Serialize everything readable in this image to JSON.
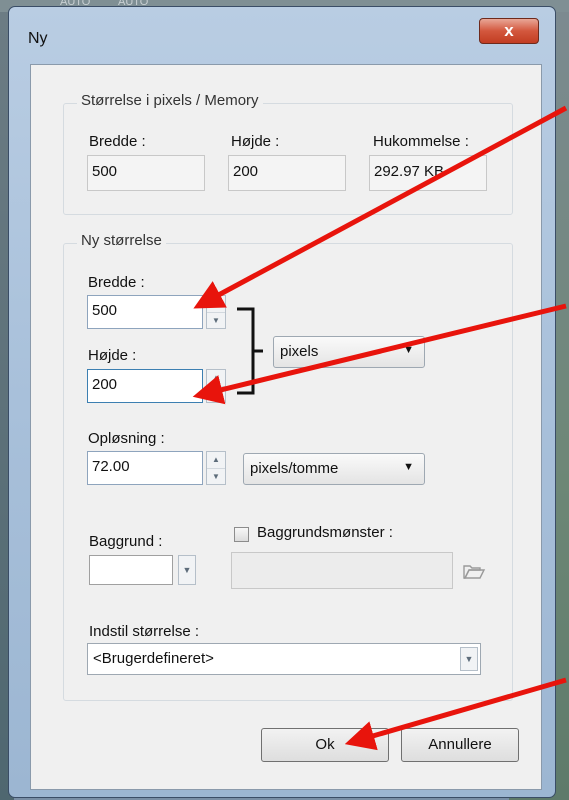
{
  "window": {
    "title": "Ny",
    "close_glyph": "x",
    "top_strip": [
      "AUTO",
      "AUTO"
    ]
  },
  "size_group": {
    "title": "Størrelse i pixels / Memory",
    "width_label": "Bredde :",
    "width_value": "500",
    "height_label": "Højde :",
    "height_value": "200",
    "memory_label": "Hukommelse :",
    "memory_value": "292.97 KB"
  },
  "new_size_group": {
    "title": "Ny størrelse",
    "width_label": "Bredde :",
    "width_value": "500",
    "height_label": "Højde :",
    "height_value": "200",
    "unit_value": "pixels",
    "resolution_label": "Opløsning :",
    "resolution_value": "72.00",
    "resolution_unit": "pixels/tomme",
    "background_label": "Baggrund :",
    "background_color": "#ffffff",
    "pattern_label": "Baggrundsmønster :",
    "preset_label": "Indstil størrelse :",
    "preset_value": "<Brugerdefineret>"
  },
  "buttons": {
    "ok": "Ok",
    "cancel": "Annullere"
  },
  "colors": {
    "annotation_arrow": "#e8140c",
    "close_button": "#c94328"
  }
}
